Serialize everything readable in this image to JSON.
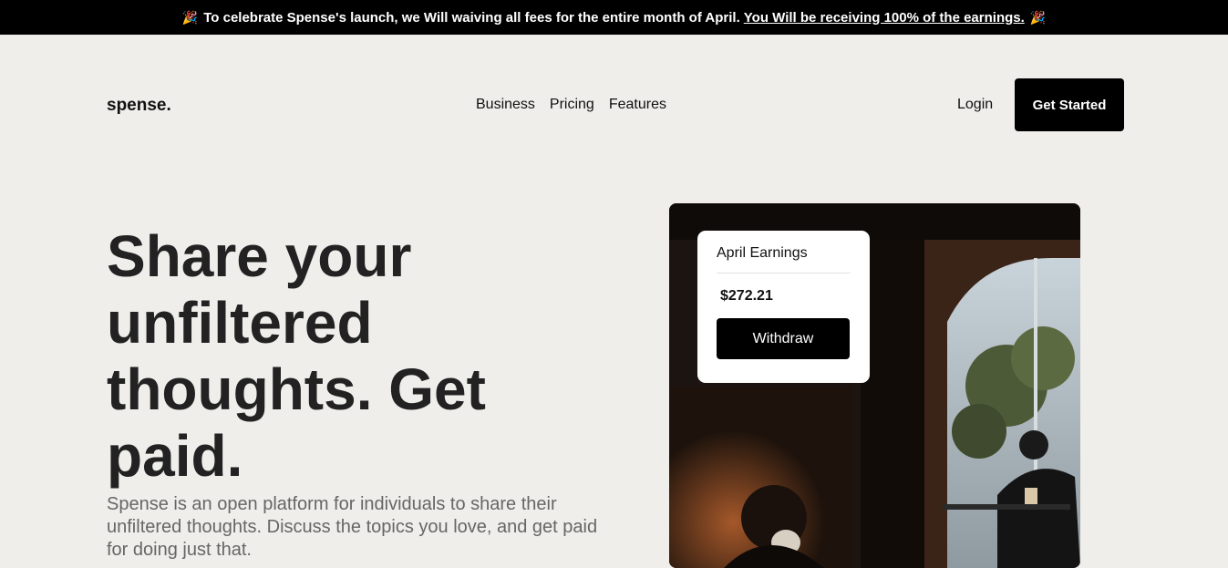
{
  "banner": {
    "emoji": "🎉",
    "text": "To celebrate Spense's launch, we Will waiving all fees for the entire month of April.",
    "link": "You Will be receiving 100% of the earnings."
  },
  "header": {
    "logo": "spense.",
    "nav": [
      "Business",
      "Pricing",
      "Features"
    ],
    "login": "Login",
    "cta": "Get Started"
  },
  "hero": {
    "title": "Share your unfiltered thoughts. Get paid.",
    "subtitle": "Spense is an open platform for individuals to share their unfiltered thoughts. Discuss the topics you love, and get paid for doing just that."
  },
  "earnings_card": {
    "title": "April Earnings",
    "amount": "$272.21",
    "button": "Withdraw"
  }
}
